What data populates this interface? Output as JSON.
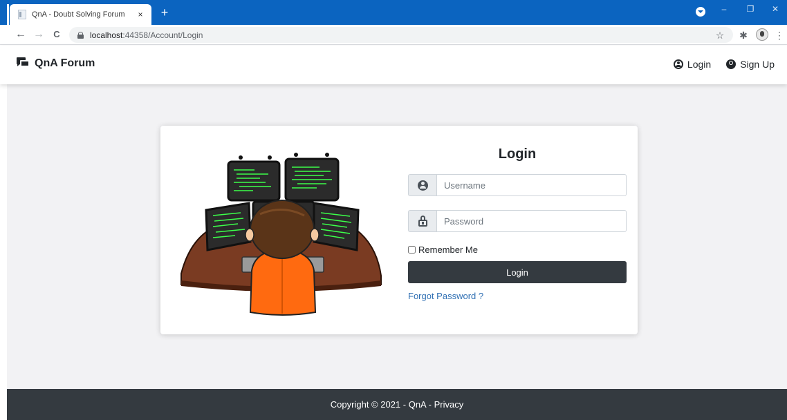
{
  "browser": {
    "tab_title": "QnA - Doubt Solving Forum",
    "tab_close": "×",
    "new_tab": "+",
    "url_host": "localhost",
    "url_path": ":44358/Account/Login",
    "window_controls": {
      "minimize": "–",
      "restore": "❐",
      "close": "✕"
    },
    "nav": {
      "back": "←",
      "forward": "→",
      "reload": "C"
    },
    "toolbar": {
      "bookmark": "☆",
      "extensions": "✱",
      "menu": "⋮"
    }
  },
  "navbar": {
    "brand": "QnA Forum",
    "links": [
      {
        "label": "Login",
        "icon": "user-circle-outline-icon"
      },
      {
        "label": "Sign Up",
        "icon": "user-circle-filled-icon"
      }
    ]
  },
  "login_form": {
    "title": "Login",
    "username_placeholder": "Username",
    "password_placeholder": "Password",
    "remember_label": "Remember Me",
    "remember_checked": false,
    "submit_label": "Login",
    "forgot_link": "Forgot Password ?"
  },
  "footer": {
    "prefix": "Copyright © 2021 - QnA - ",
    "privacy": "Privacy"
  },
  "colors": {
    "browser_blue": "#0b64c0",
    "dark": "#343a40",
    "page_bg": "#f2f2f4",
    "link": "#2f6fb3",
    "monitor_code": "#3cff4a",
    "shirt": "#ff6a10",
    "desk": "#7a3b22"
  }
}
